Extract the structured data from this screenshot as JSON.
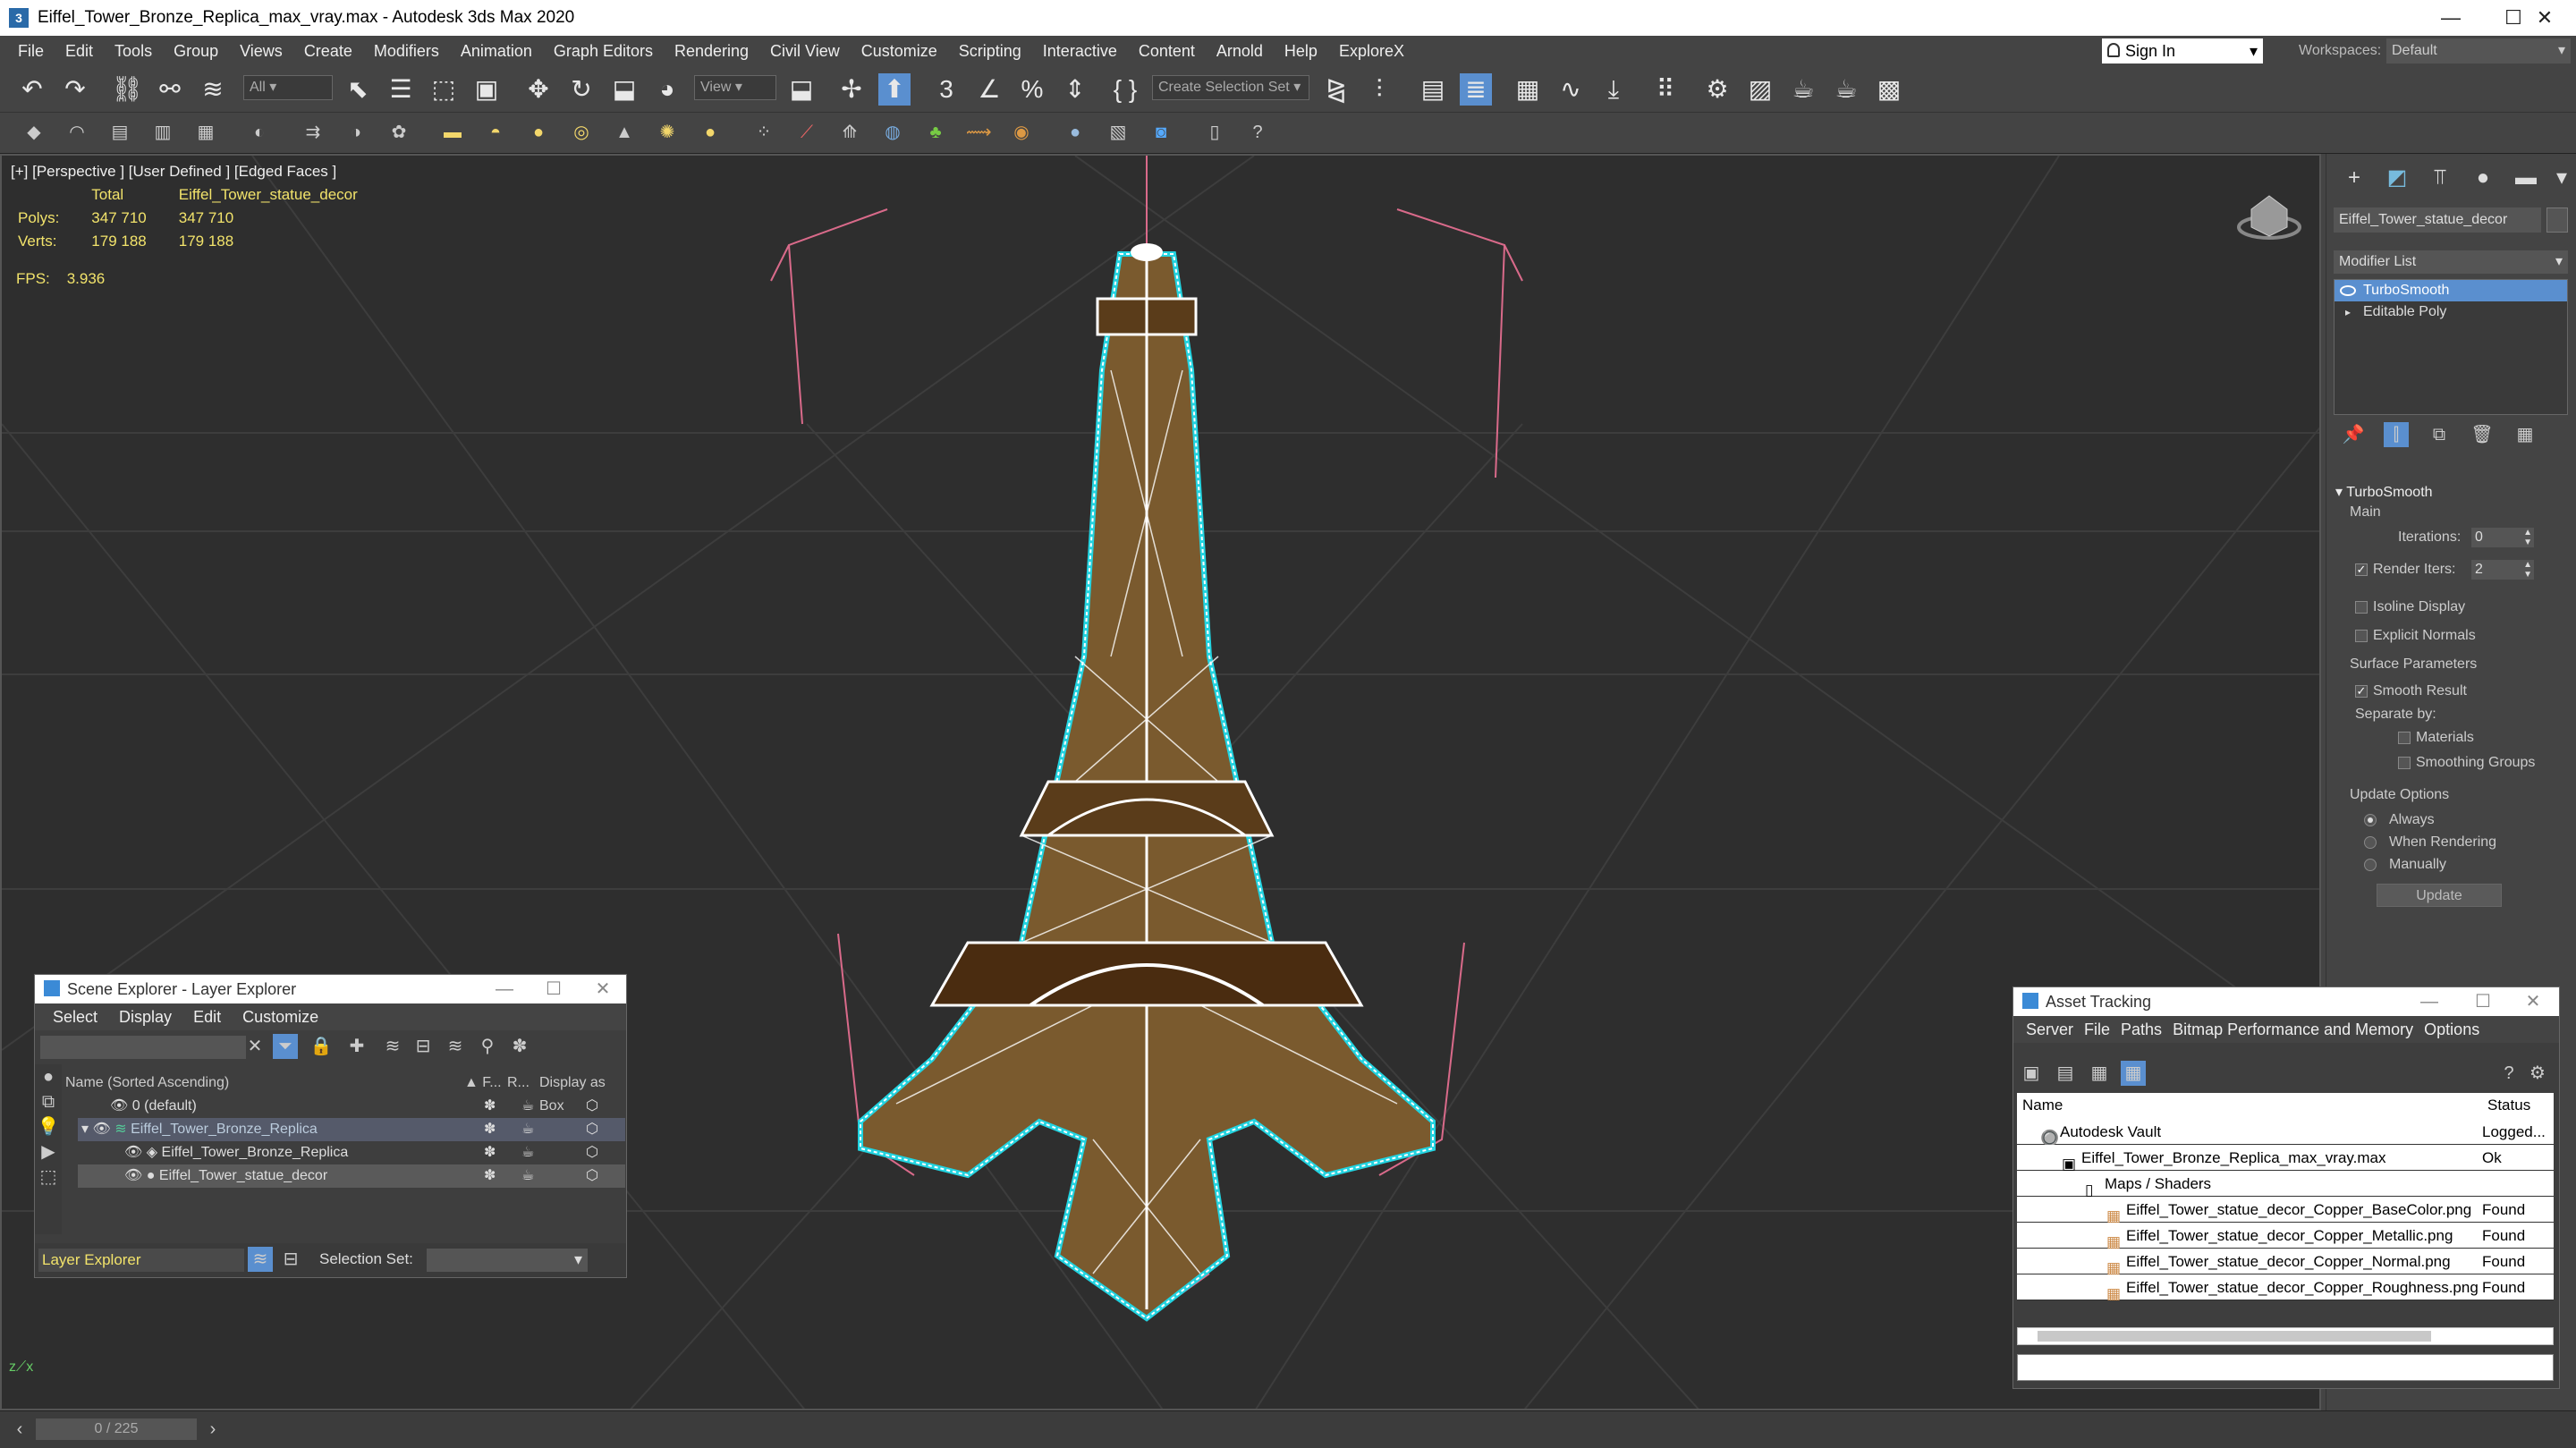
{
  "window": {
    "title": "Eiffel_Tower_Bronze_Replica_max_vray.max - Autodesk 3ds Max 2020",
    "app_icon": "3"
  },
  "menu": [
    "File",
    "Edit",
    "Tools",
    "Group",
    "Views",
    "Create",
    "Modifiers",
    "Animation",
    "Graph Editors",
    "Rendering",
    "Civil View",
    "Customize",
    "Scripting",
    "Interactive",
    "Content",
    "Arnold",
    "Help",
    "ExploreX"
  ],
  "account": {
    "sign_in": "Sign In",
    "workspaces_label": "Workspaces:",
    "workspace": "Default"
  },
  "toolbar": {
    "filter": "All",
    "ref_coord": "View",
    "selection_set": "Create Selection Set"
  },
  "viewport": {
    "label": "[+] [Perspective ] [User Defined ] [Edged Faces ]",
    "stats_header_total": "Total",
    "stats_header_obj": "Eiffel_Tower_statue_decor",
    "polys_label": "Polys:",
    "polys_total": "347 710",
    "polys_obj": "347 710",
    "verts_label": "Verts:",
    "verts_total": "179 188",
    "verts_obj": "179 188",
    "fps_label": "FPS:",
    "fps_value": "3.936"
  },
  "command_panel": {
    "object_name": "Eiffel_Tower_statue_decor",
    "modifier_list": "Modifier List",
    "stack": [
      "TurboSmooth",
      "Editable Poly"
    ],
    "rollout_title": "TurboSmooth",
    "main": "Main",
    "iterations_label": "Iterations:",
    "iterations": "0",
    "render_iters_label": "Render Iters:",
    "render_iters": "2",
    "isoline": "Isoline Display",
    "explicit_normals": "Explicit Normals",
    "surface_params": "Surface Parameters",
    "smooth_result": "Smooth Result",
    "separate_by": "Separate by:",
    "materials": "Materials",
    "smoothing_groups": "Smoothing Groups",
    "update_options": "Update Options",
    "always": "Always",
    "when_rendering": "When Rendering",
    "manually": "Manually",
    "update": "Update"
  },
  "scene_explorer": {
    "title": "Scene Explorer - Layer Explorer",
    "menu": [
      "Select",
      "Display",
      "Edit",
      "Customize"
    ],
    "col_name": "Name (Sorted Ascending)",
    "col_f": "▲ F...",
    "col_r": "R...",
    "col_box": "Display as Box",
    "rows": [
      "0 (default)",
      "Eiffel_Tower_Bronze_Replica",
      "Eiffel_Tower_Bronze_Replica",
      "Eiffel_Tower_statue_decor"
    ],
    "footer_layer": "Layer Explorer",
    "footer_selset": "Selection Set:"
  },
  "asset_tracking": {
    "title": "Asset Tracking",
    "menu": [
      "Server",
      "File",
      "Paths",
      "Bitmap Performance and Memory",
      "Options"
    ],
    "col_name": "Name",
    "col_status": "Status",
    "rows": [
      {
        "name": "Autodesk Vault",
        "status": "Logged..."
      },
      {
        "name": "Eiffel_Tower_Bronze_Replica_max_vray.max",
        "status": "Ok"
      },
      {
        "name": "Maps / Shaders",
        "status": ""
      },
      {
        "name": "Eiffel_Tower_statue_decor_Copper_BaseColor.png",
        "status": "Found"
      },
      {
        "name": "Eiffel_Tower_statue_decor_Copper_Metallic.png",
        "status": "Found"
      },
      {
        "name": "Eiffel_Tower_statue_decor_Copper_Normal.png",
        "status": "Found"
      },
      {
        "name": "Eiffel_Tower_statue_decor_Copper_Roughness.png",
        "status": "Found"
      }
    ]
  },
  "timeline": {
    "frame": "0 / 225"
  },
  "colors": {
    "accent": "#5a8fcf",
    "stats": "#f2e36b",
    "wire": "#ffffff",
    "selection": "#22d3e0"
  }
}
